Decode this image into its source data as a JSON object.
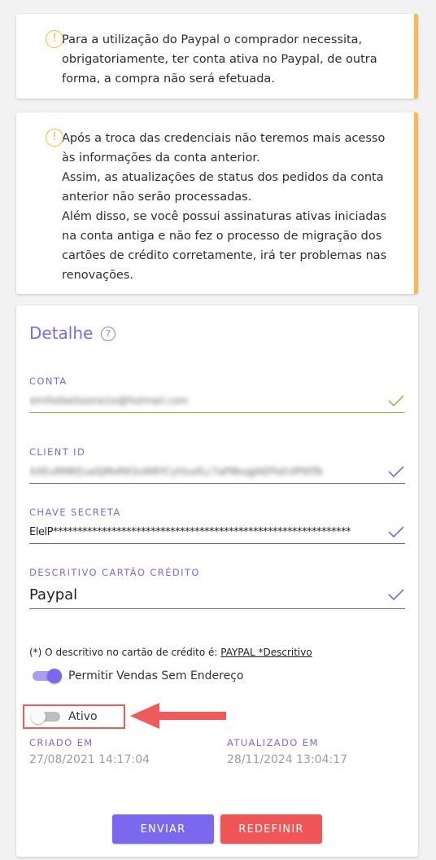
{
  "alerts": [
    {
      "text": "Para a utilização do Paypal o comprador necessita, obrigatoriamente, ter conta ativa no Paypal, de outra forma, a compra não será efetuada."
    },
    {
      "lines": [
        "Após a troca das credenciais não teremos mais acesso às informações da conta anterior.",
        "Assim, as atualizações de status dos pedidos da conta anterior não serão processadas.",
        "Além disso, se você possui assinaturas ativas iniciadas na conta antiga e não fez o processo de migração dos cartões de crédito corretamente, irá ter problemas nas renovações."
      ]
    }
  ],
  "alert_icon": "!",
  "detail": {
    "title": "Detalhe",
    "help_icon": "?"
  },
  "fields": {
    "conta": {
      "label": "CONTA",
      "value": "emiliofaelssone1e@hotmail.com"
    },
    "client_id": {
      "label": "CLIENT ID",
      "value": "AXEuRMKEuaSjMoRKSxW8YCyhlusfLc7aP8ksgJAEPloh3PtKflk"
    },
    "chave": {
      "label": "CHAVE SECRETA",
      "value": "EIelP*************************************************************"
    },
    "descritivo": {
      "label": "DESCRITIVO CARTÃO CRÉDITO",
      "value": "Paypal"
    }
  },
  "note": {
    "prefix": "(*) O descritivo no cartão de crédito é: ",
    "link": "PAYPAL *Descritivo"
  },
  "toggles": {
    "vendas": {
      "label": "Permitir Vendas Sem Endereço",
      "on": true
    },
    "ativo": {
      "label": "Ativo",
      "on": false
    }
  },
  "meta": {
    "criado": {
      "label": "CRIADO EM",
      "value": "27/08/2021 14:17:04"
    },
    "atualizado": {
      "label": "ATUALIZADO EM",
      "value": "28/11/2024 13:04:17"
    }
  },
  "buttons": {
    "enviar": "ENVIAR",
    "redefinir": "REDEFINIR"
  },
  "colors": {
    "accent": "#7b68ee",
    "warning": "#ffb84d",
    "danger": "#f05656",
    "valid": "#8bc34a"
  }
}
